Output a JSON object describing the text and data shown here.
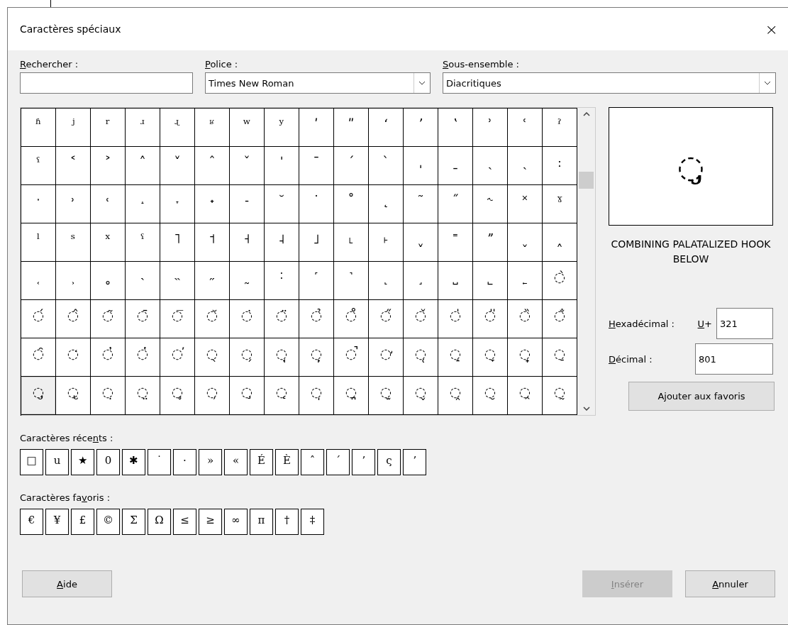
{
  "window": {
    "title": "Caractères spéciaux",
    "close": "×"
  },
  "search": {
    "label": {
      "key": "R",
      "post": "echercher :"
    }
  },
  "font": {
    "label": {
      "key": "P",
      "post": "olice :"
    },
    "value": "Times New Roman"
  },
  "subset": {
    "label": {
      "key": "S",
      "post": "ous-ensemble :"
    },
    "value": "Diacritiques"
  },
  "grid": [
    [
      {
        "ch": "ʱ",
        "selected": false
      },
      {
        "ch": "ʲ",
        "selected": false
      },
      {
        "ch": "ʳ",
        "selected": false
      },
      {
        "ch": "ʴ",
        "selected": false
      },
      {
        "ch": "ʵ",
        "selected": false
      },
      {
        "ch": "ʶ",
        "selected": false
      },
      {
        "ch": "ʷ",
        "selected": false
      },
      {
        "ch": "ʸ",
        "selected": false
      },
      {
        "ch": "ʹ",
        "selected": false
      },
      {
        "ch": "ʺ",
        "selected": false
      },
      {
        "ch": "ʻ",
        "selected": false
      },
      {
        "ch": "ʼ",
        "selected": false
      },
      {
        "ch": "ʽ",
        "selected": false
      },
      {
        "ch": "ʾ",
        "selected": false
      },
      {
        "ch": "ʿ",
        "selected": false
      },
      {
        "ch": "ˀ",
        "selected": false
      }
    ],
    [
      {
        "ch": "ˁ",
        "selected": false
      },
      {
        "ch": "˂",
        "selected": false
      },
      {
        "ch": "˃",
        "selected": false
      },
      {
        "ch": "˄",
        "selected": false
      },
      {
        "ch": "˅",
        "selected": false
      },
      {
        "ch": "ˆ",
        "selected": false
      },
      {
        "ch": "ˇ",
        "selected": false
      },
      {
        "ch": "ˈ",
        "selected": false
      },
      {
        "ch": "ˉ",
        "selected": false
      },
      {
        "ch": "ˊ",
        "selected": false
      },
      {
        "ch": "ˋ",
        "selected": false
      },
      {
        "ch": "ˌ",
        "selected": false
      },
      {
        "ch": "ˍ",
        "selected": false
      },
      {
        "ch": "ˎ",
        "selected": false
      },
      {
        "ch": "ˏ",
        "selected": false
      },
      {
        "ch": "ː",
        "selected": false
      }
    ],
    [
      {
        "ch": "ˑ",
        "selected": false
      },
      {
        "ch": "˒",
        "selected": false
      },
      {
        "ch": "˓",
        "selected": false
      },
      {
        "ch": "˔",
        "selected": false
      },
      {
        "ch": "˕",
        "selected": false
      },
      {
        "ch": "˖",
        "selected": false
      },
      {
        "ch": "˗",
        "selected": false
      },
      {
        "ch": "˘",
        "selected": false
      },
      {
        "ch": "˙",
        "selected": false
      },
      {
        "ch": "˚",
        "selected": false
      },
      {
        "ch": "˛",
        "selected": false
      },
      {
        "ch": "˜",
        "selected": false
      },
      {
        "ch": "˝",
        "selected": false
      },
      {
        "ch": "˞",
        "selected": false
      },
      {
        "ch": "˟",
        "selected": false
      },
      {
        "ch": "ˠ",
        "selected": false
      }
    ],
    [
      {
        "ch": "ˡ",
        "selected": false
      },
      {
        "ch": "ˢ",
        "selected": false
      },
      {
        "ch": "ˣ",
        "selected": false
      },
      {
        "ch": "ˤ",
        "selected": false
      },
      {
        "ch": "˥",
        "selected": false
      },
      {
        "ch": "˦",
        "selected": false
      },
      {
        "ch": "˧",
        "selected": false
      },
      {
        "ch": "˨",
        "selected": false
      },
      {
        "ch": "˩",
        "selected": false
      },
      {
        "ch": "˪",
        "selected": false
      },
      {
        "ch": "˫",
        "selected": false
      },
      {
        "ch": "ˬ",
        "selected": false
      },
      {
        "ch": "˭",
        "selected": false
      },
      {
        "ch": "ˮ",
        "selected": false
      },
      {
        "ch": "˯",
        "selected": false
      },
      {
        "ch": "˰",
        "selected": false
      }
    ],
    [
      {
        "ch": "˱",
        "selected": false
      },
      {
        "ch": "˲",
        "selected": false
      },
      {
        "ch": "˳",
        "selected": false
      },
      {
        "ch": "˴",
        "selected": false
      },
      {
        "ch": "˵",
        "selected": false
      },
      {
        "ch": "˶",
        "selected": false
      },
      {
        "ch": "˷",
        "selected": false
      },
      {
        "ch": "˸",
        "selected": false
      },
      {
        "ch": "˹",
        "selected": false
      },
      {
        "ch": "˺",
        "selected": false
      },
      {
        "ch": "˻",
        "selected": false
      },
      {
        "ch": "˼",
        "selected": false
      },
      {
        "ch": "˽",
        "selected": false
      },
      {
        "ch": "˾",
        "selected": false
      },
      {
        "ch": "˿",
        "selected": false
      },
      {
        "ch": "◌̀",
        "selected": false
      }
    ],
    [
      {
        "ch": "◌́",
        "selected": false
      },
      {
        "ch": "◌̂",
        "selected": false
      },
      {
        "ch": "◌̃",
        "selected": false
      },
      {
        "ch": "◌̄",
        "selected": false
      },
      {
        "ch": "◌̅",
        "selected": false
      },
      {
        "ch": "◌̆",
        "selected": false
      },
      {
        "ch": "◌̇",
        "selected": false
      },
      {
        "ch": "◌̈",
        "selected": false
      },
      {
        "ch": "◌̉",
        "selected": false
      },
      {
        "ch": "◌̊",
        "selected": false
      },
      {
        "ch": "◌̋",
        "selected": false
      },
      {
        "ch": "◌̌",
        "selected": false
      },
      {
        "ch": "◌̍",
        "selected": false
      },
      {
        "ch": "◌̎",
        "selected": false
      },
      {
        "ch": "◌̏",
        "selected": false
      },
      {
        "ch": "◌̐",
        "selected": false
      }
    ],
    [
      {
        "ch": "◌̑",
        "selected": false
      },
      {
        "ch": "◌̒",
        "selected": false
      },
      {
        "ch": "◌̓",
        "selected": false
      },
      {
        "ch": "◌̔",
        "selected": false
      },
      {
        "ch": "◌̕",
        "selected": false
      },
      {
        "ch": "◌̖",
        "selected": false
      },
      {
        "ch": "◌̗",
        "selected": false
      },
      {
        "ch": "◌̘",
        "selected": false
      },
      {
        "ch": "◌̙",
        "selected": false
      },
      {
        "ch": "◌̚",
        "selected": false
      },
      {
        "ch": "◌̛",
        "selected": false
      },
      {
        "ch": "◌̜",
        "selected": false
      },
      {
        "ch": "◌̝",
        "selected": false
      },
      {
        "ch": "◌̞",
        "selected": false
      },
      {
        "ch": "◌̟",
        "selected": false
      },
      {
        "ch": "◌̠",
        "selected": false
      }
    ],
    [
      {
        "ch": "◌̡",
        "selected": true
      },
      {
        "ch": "◌̢",
        "selected": false
      },
      {
        "ch": "◌̣",
        "selected": false
      },
      {
        "ch": "◌̤",
        "selected": false
      },
      {
        "ch": "◌̥",
        "selected": false
      },
      {
        "ch": "◌̦",
        "selected": false
      },
      {
        "ch": "◌̧",
        "selected": false
      },
      {
        "ch": "◌̨",
        "selected": false
      },
      {
        "ch": "◌̩",
        "selected": false
      },
      {
        "ch": "◌̪",
        "selected": false
      },
      {
        "ch": "◌̫",
        "selected": false
      },
      {
        "ch": "◌̬",
        "selected": false
      },
      {
        "ch": "◌̭",
        "selected": false
      },
      {
        "ch": "◌̮",
        "selected": false
      },
      {
        "ch": "◌̯",
        "selected": false
      },
      {
        "ch": "◌̰",
        "selected": false
      }
    ]
  ],
  "preview": {
    "ch": "◌̡",
    "name": "COMBINING PALATALIZED HOOK BELOW"
  },
  "hex": {
    "label": {
      "key": "H",
      "post": "exadécimal :"
    },
    "prefix": {
      "key": "U",
      "post": "+"
    },
    "value": "321"
  },
  "decimal": {
    "label": {
      "key": "D",
      "post": "écimal :"
    },
    "value": "801"
  },
  "add_favorite": "Ajouter aux favoris",
  "recent": {
    "label": {
      "pre": "Caractères réce",
      "key": "n",
      "post": "ts :"
    },
    "chars": [
      "□",
      "u",
      "★",
      "0",
      "✱",
      "˙",
      "·",
      "»",
      "«",
      "É",
      "È",
      "ˆ",
      "ˊ",
      "ʼ",
      "ς",
      "ʼ"
    ]
  },
  "favorites": {
    "label": {
      "pre": "Caractères fa",
      "key": "v",
      "post": "oris :"
    },
    "chars": [
      "€",
      "¥",
      "£",
      "©",
      "Σ",
      "Ω",
      "≤",
      "≥",
      "∞",
      "π",
      "†",
      "‡"
    ]
  },
  "buttons": [
    {
      "label": {
        "key": "A",
        "post": "ide"
      },
      "disabled": false,
      "kind": "help"
    },
    {
      "label": {
        "key": "I",
        "post": "nsérer"
      },
      "disabled": true,
      "kind": "action"
    },
    {
      "label": {
        "key": "A",
        "post": "nnuler"
      },
      "disabled": false,
      "kind": "action"
    }
  ]
}
